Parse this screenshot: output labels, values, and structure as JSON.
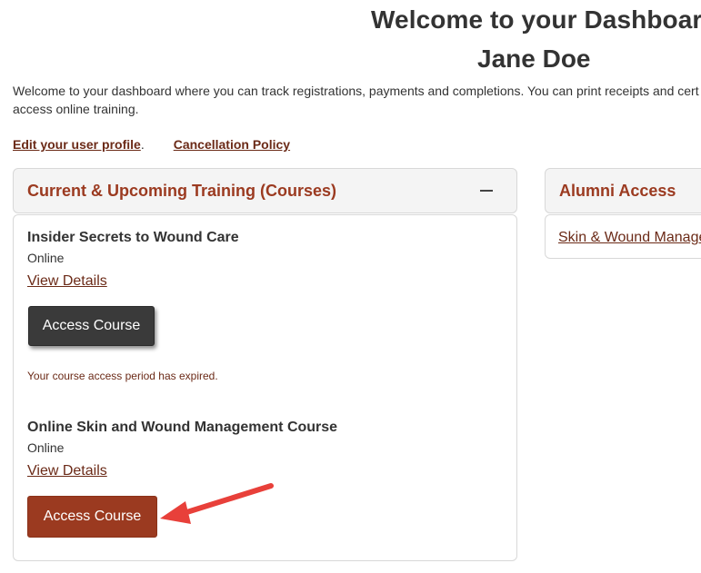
{
  "header": {
    "title": "Welcome to your Dashboard",
    "user_name": "Jane Doe"
  },
  "intro": {
    "line1": "Welcome to your dashboard where you can track registrations, payments and completions.  You can print receipts and cert",
    "line2": "access online training."
  },
  "links": {
    "edit_profile": "Edit your user profile",
    "edit_profile_suffix": ".",
    "cancellation_policy": "Cancellation Policy"
  },
  "current_panel": {
    "title": "Current & Upcoming Training (Courses)",
    "courses": [
      {
        "title": "Insider Secrets to Wound Care",
        "mode": "Online",
        "details_label": "View Details",
        "button_label": "Access Course",
        "status": "Your course access period has expired."
      },
      {
        "title": "Online Skin and Wound Management Course",
        "mode": "Online",
        "details_label": "View Details",
        "button_label": "Access Course"
      }
    ]
  },
  "alumni_panel": {
    "title": "Alumni Access",
    "link": "Skin & Wound Manage"
  },
  "colors": {
    "accent": "#9b3a20",
    "link": "#6b2a17",
    "disabled_button": "#3a3a3a",
    "annotation_arrow": "#e8403a"
  }
}
